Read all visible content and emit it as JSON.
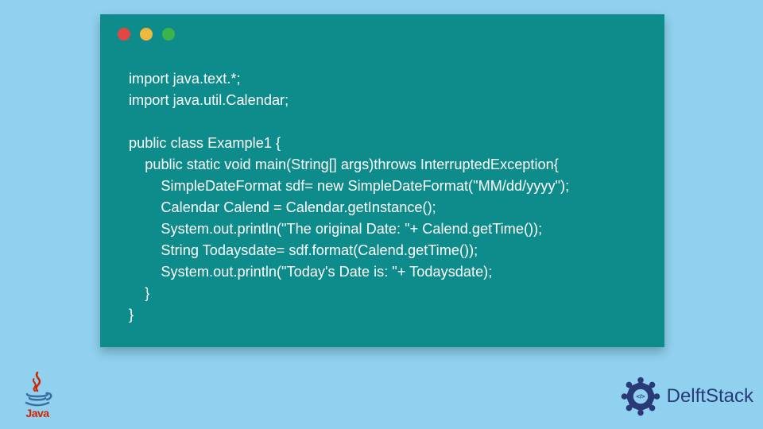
{
  "colors": {
    "background": "#8fd1ee",
    "panel": "#0e8b8b",
    "codeText": "#ffffff",
    "trafficRed": "#e24841",
    "trafficYellow": "#f0b93e",
    "trafficGreen": "#3bb44a",
    "javaRed": "#d22300",
    "javaBlue": "#3a6ea5",
    "delftBlue": "#2a3a77"
  },
  "code": {
    "lines": [
      "import java.text.*;",
      "import java.util.Calendar;",
      "",
      "public class Example1 {",
      "    public static void main(String[] args)throws InterruptedException{",
      "        SimpleDateFormat sdf= new SimpleDateFormat(\"MM/dd/yyyy\");",
      "        Calendar Calend = Calendar.getInstance();",
      "        System.out.println(\"The original Date: \"+ Calend.getTime());",
      "        String Todaysdate= sdf.format(Calend.getTime());",
      "        System.out.println(\"Today's Date is: \"+ Todaysdate);",
      "    }",
      "}"
    ]
  },
  "logos": {
    "java": {
      "label": "Java"
    },
    "delft": {
      "label": "DelftStack"
    }
  },
  "traffic": {
    "red": "close",
    "yellow": "minimize",
    "green": "zoom"
  }
}
